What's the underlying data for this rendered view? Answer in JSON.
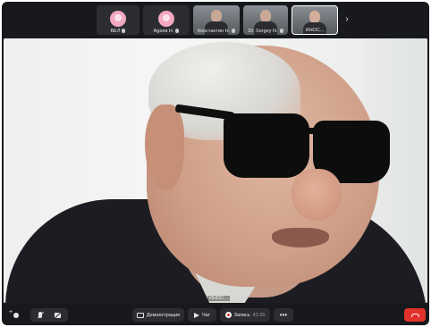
{
  "participants": [
    {
      "name": "ВЕЛ",
      "avatar": "pink-user-avatar",
      "muted": true
    },
    {
      "name": "Agеев Н.",
      "avatar": "pink-user-avatar",
      "muted": true
    },
    {
      "name": "Константин Н.",
      "avatar": "video",
      "muted": true
    },
    {
      "name": "Dr. Sergey N.",
      "avatar": "video",
      "muted": true
    },
    {
      "name": "ИНОС...",
      "avatar": "video",
      "muted": false,
      "active": true
    }
  ],
  "strip_next_icon": "chevron-right-icon",
  "main_video": {
    "speaker_label": "ИНОС..."
  },
  "toolbar": {
    "invite_icon": "add-person-icon",
    "mic_icon": "mic-off-icon",
    "camera_icon": "camera-off-icon",
    "screen_share_label": "Демонстрация",
    "chat_label": "Чат",
    "record_label": "Запись",
    "record_time": "42:39",
    "more_label": "•••",
    "hangup_icon": "phone-hangup-icon"
  },
  "colors": {
    "app_background": "#17191c",
    "button_background": "#2b2d31",
    "hangup": "#e1322b",
    "record_dot": "#e5332a"
  }
}
